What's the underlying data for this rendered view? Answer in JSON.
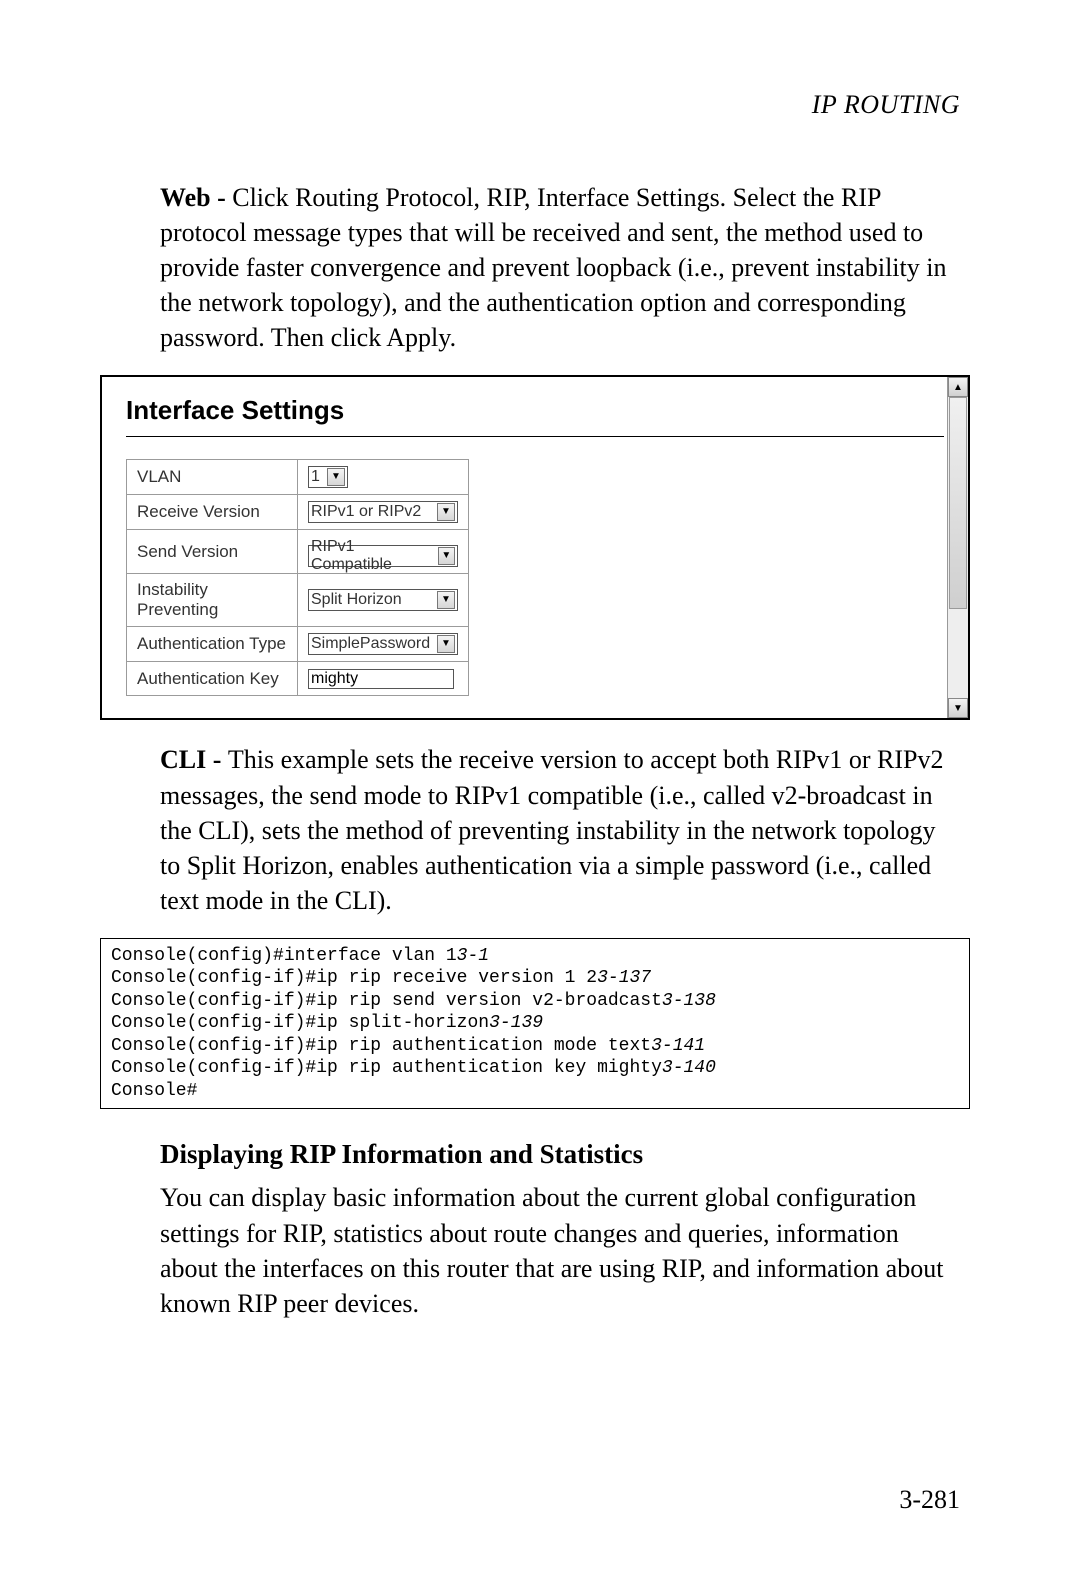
{
  "running_head": "IP ROUTING",
  "intro": {
    "web_label": "Web - ",
    "web_text": "Click Routing Protocol, RIP, Interface Settings. Select the RIP protocol message types that will be received and sent, the method used to provide faster convergence and prevent loopback (i.e., prevent instability in the network topology), and the authentication option and corresponding password. Then click Apply."
  },
  "ui": {
    "title": "Interface Settings",
    "rows": [
      {
        "label": "VLAN",
        "type": "select",
        "value": "1"
      },
      {
        "label": "Receive Version",
        "type": "select",
        "value": "RIPv1 or RIPv2"
      },
      {
        "label": "Send Version",
        "type": "select",
        "value": "RIPv1 Compatible"
      },
      {
        "label": "Instability Preventing",
        "type": "select",
        "value": "Split Horizon"
      },
      {
        "label": "Authentication Type",
        "type": "select",
        "value": "SimplePassword"
      },
      {
        "label": "Authentication Key",
        "type": "text",
        "value": "mighty"
      }
    ]
  },
  "cli_intro": {
    "label": "CLI - ",
    "text": "This example sets the receive version to accept both RIPv1 or RIPv2 messages, the send mode to RIPv1 compatible (i.e., called v2-broadcast in the CLI), sets the method of preventing instability in the network topology to Split Horizon, enables authentication via a simple password (i.e., called text mode in the CLI)."
  },
  "cli_lines": [
    {
      "cmd": "Console(config)#interface vlan 1",
      "ref": "3-1"
    },
    {
      "cmd": "Console(config-if)#ip rip receive version 1 2",
      "ref": "3-137"
    },
    {
      "cmd": "Console(config-if)#ip rip send version v2-broadcast",
      "ref": "3-138"
    },
    {
      "cmd": "Console(config-if)#ip split-horizon",
      "ref": "3-139"
    },
    {
      "cmd": "Console(config-if)#ip rip authentication mode text",
      "ref": "3-141"
    },
    {
      "cmd": "Console(config-if)#ip rip authentication key mighty",
      "ref": "3-140"
    },
    {
      "cmd": "Console#",
      "ref": ""
    }
  ],
  "section2": {
    "heading": "Displaying RIP Information and Statistics",
    "body": "You can display basic information about the current global configuration settings for RIP, statistics about route changes and queries, information about the interfaces on this router that are using RIP, and information about known RIP peer devices."
  },
  "page_number": "3-281"
}
